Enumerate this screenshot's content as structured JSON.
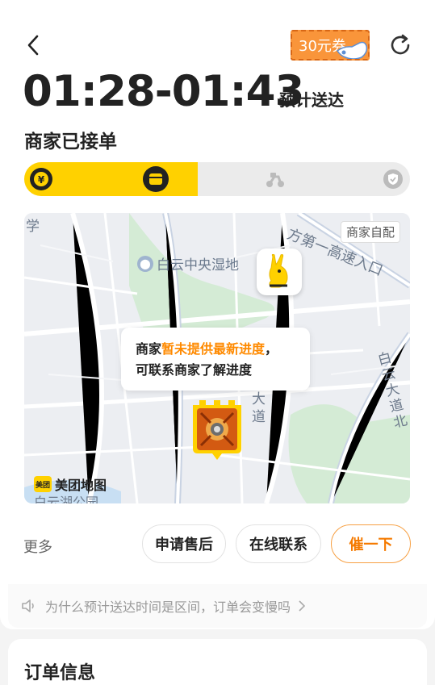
{
  "header": {
    "promo_label": "30元券",
    "eta_time": "01:28-01:43",
    "eta_label": "预计送达",
    "status": "商家已接单"
  },
  "progress": {
    "fraction": 0.45,
    "steps": [
      "yen-icon",
      "shop-icon",
      "scooter-icon",
      "check-icon"
    ],
    "active_color": "#ffd100"
  },
  "map": {
    "pickup_tag": "商家自配",
    "wetland_label": "白云中央湿地",
    "road_label": "方第一高速入口",
    "avenue_label_1": "白云大道北",
    "avenue_label_2": "大道",
    "lake_label": "白云湖公园",
    "xue_label": "学",
    "tooltip_prefix": "商家",
    "tooltip_highlight": "暂未提供最新进度",
    "tooltip_suffix": "，",
    "tooltip_line2": "可联系商家了解进度",
    "logo_text": "美团地图",
    "logo_badge": "美团"
  },
  "actions": {
    "more": "更多",
    "after_sales": "申请售后",
    "contact": "在线联系",
    "urge": "催一下"
  },
  "tip": {
    "text": "为什么预计送达时间是区间，订单会变慢吗"
  },
  "order": {
    "title": "订单信息"
  },
  "colors": {
    "brand_yellow": "#ffd100",
    "accent_orange": "#ff8a00"
  }
}
